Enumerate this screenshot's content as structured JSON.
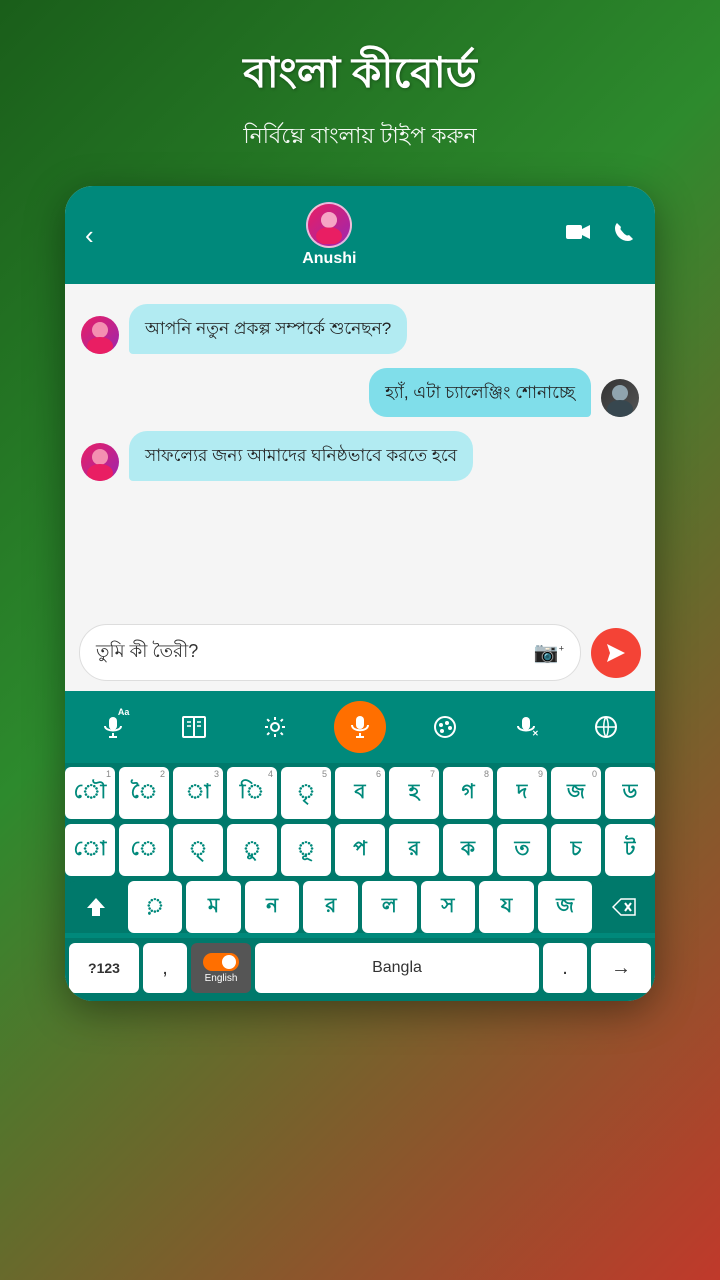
{
  "header": {
    "title": "বাংলা কীবোর্ড",
    "subtitle": "নির্বিঘ্নে বাংলায় টাইপ করুন"
  },
  "chat": {
    "contact_name": "Anushi",
    "messages": [
      {
        "type": "incoming",
        "text": "আপনি নতুন প্রকল্প সম্পর্কে শুনেছন?"
      },
      {
        "type": "outgoing",
        "text": "হ্যাঁ, এটা চ্যালেঞ্জিং শোনাচ্ছে"
      },
      {
        "type": "incoming",
        "text": "সাফল্যের জন্য আমাদের ঘনিষ্ঠভাবে করতে হবে"
      }
    ],
    "input_text": "তুমি কী তৈরী?",
    "input_placeholder": "তুমি কী তৈরী?"
  },
  "keyboard": {
    "toolbar": {
      "voice_label": "🎤",
      "book_label": "📖",
      "settings_label": "⚙",
      "mic_label": "🎤",
      "palette_label": "🎨",
      "translate_label": "🎤",
      "globe_label": "🌐"
    },
    "rows": [
      [
        "ৌ",
        "ৈ",
        "া",
        "ি",
        "ৃ",
        "ব",
        "হ",
        "গ",
        "দ",
        "জ",
        "ড"
      ],
      [
        "ো",
        "ে",
        "্",
        "ু",
        "ূ",
        "প",
        "র",
        "ক",
        "ত",
        "চ",
        "ট"
      ],
      [
        "shift",
        "়",
        "ম",
        "ন",
        "র",
        "ল",
        "স",
        "য",
        "জ",
        "⌫"
      ]
    ],
    "bottom": {
      "numbers_label": "?123",
      "comma": ",",
      "language": "English",
      "space_label": "Bangla",
      "period": ".",
      "enter": "→"
    }
  }
}
